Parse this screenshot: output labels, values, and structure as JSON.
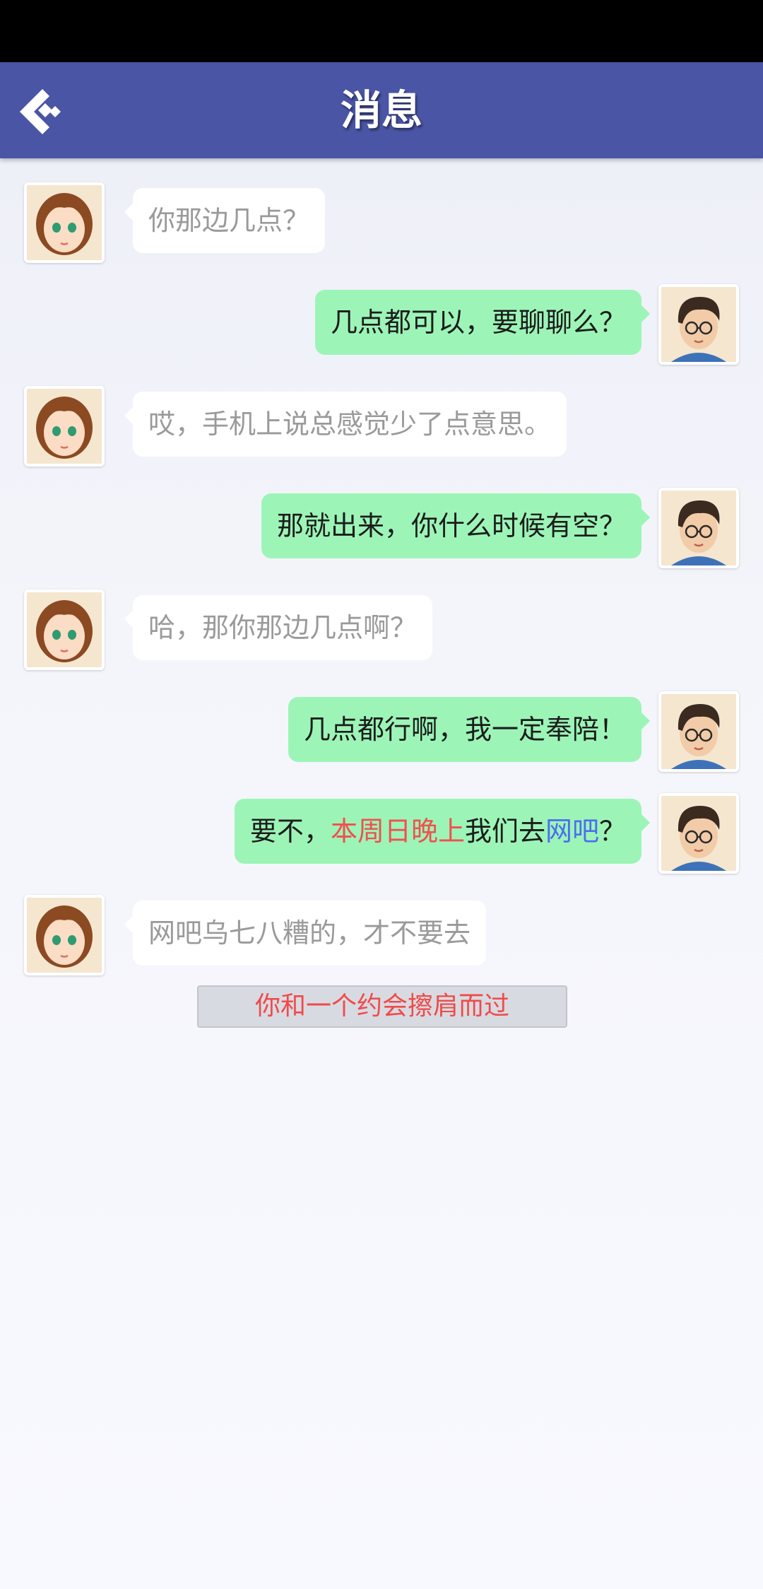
{
  "header": {
    "title": "消息",
    "back_icon": "back-chevron-icon"
  },
  "colors": {
    "header": "#4a55a6",
    "incoming_bubble": "#ffffff",
    "outgoing_bubble": "#9cf5b7",
    "highlight_red": "#f24f4f",
    "highlight_blue": "#4d6df0"
  },
  "messages": [
    {
      "side": "left",
      "text": "你那边几点？"
    },
    {
      "side": "right",
      "text": "几点都可以，要聊聊么？"
    },
    {
      "side": "left",
      "text": "哎，手机上说总感觉少了点意思。"
    },
    {
      "side": "right",
      "text": "那就出来，你什么时候有空？"
    },
    {
      "side": "left",
      "text": "哈，那你那边几点啊？"
    },
    {
      "side": "right",
      "text": "几点都行啊，我一定奉陪！"
    },
    {
      "side": "right",
      "segments": [
        {
          "text": "要不，",
          "style": "normal"
        },
        {
          "text": "本周日晚上",
          "style": "red"
        },
        {
          "text": "我们去",
          "style": "normal"
        },
        {
          "text": "网吧",
          "style": "blue"
        },
        {
          "text": "？",
          "style": "normal"
        }
      ]
    },
    {
      "side": "left",
      "text": "网吧乌七八糟的，才不要去"
    }
  ],
  "system_notice": "你和一个约会擦肩而过"
}
